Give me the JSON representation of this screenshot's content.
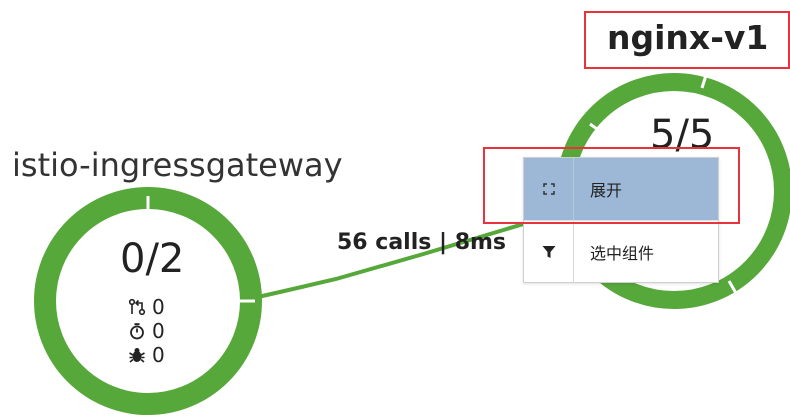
{
  "nodes": {
    "ingress": {
      "name": "istio-ingressgateway",
      "pods": "0/2",
      "metrics": {
        "requests": "0",
        "timers": "0",
        "errors": "0"
      }
    },
    "nginx": {
      "name": "nginx-v1",
      "pods": "5/5"
    }
  },
  "edge": {
    "label": "56 calls | 8ms"
  },
  "context_menu": {
    "items": [
      {
        "icon": "expand-icon",
        "label": "展开",
        "active": true
      },
      {
        "icon": "filter-icon",
        "label": "选中组件",
        "active": false
      }
    ]
  },
  "colors": {
    "ring": "#57a83a",
    "menu_highlight": "#9db8d6",
    "annotation_box": "#e8333d"
  }
}
